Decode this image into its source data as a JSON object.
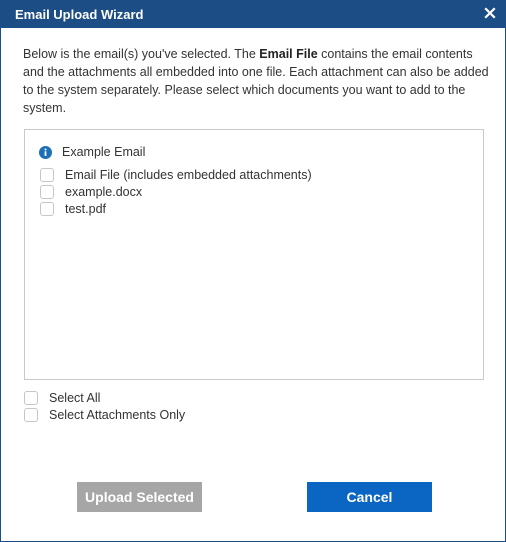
{
  "dialog": {
    "title": "Email Upload Wizard",
    "intro": {
      "part1": "Below is the email(s) you've selected. The ",
      "bold": "Email File",
      "part2": " contains the email contents and the attachments all embedded into one file. Each attachment can also be added to the system separately. Please select which documents you want to add to the system."
    },
    "email_group": {
      "name": "Example Email",
      "icon": "info-icon",
      "items": [
        {
          "label": "Email File (includes embedded attachments)",
          "checked": false
        },
        {
          "label": "example.docx",
          "checked": false
        },
        {
          "label": "test.pdf",
          "checked": false
        }
      ]
    },
    "options": {
      "select_all": "Select All",
      "select_attachments_only": "Select Attachments Only"
    },
    "buttons": {
      "upload_selected": "Upload Selected",
      "cancel": "Cancel"
    }
  },
  "colors": {
    "titlebar": "#1d4d85",
    "primary_button": "#0a66c2",
    "disabled_button": "#a6a6a6"
  }
}
